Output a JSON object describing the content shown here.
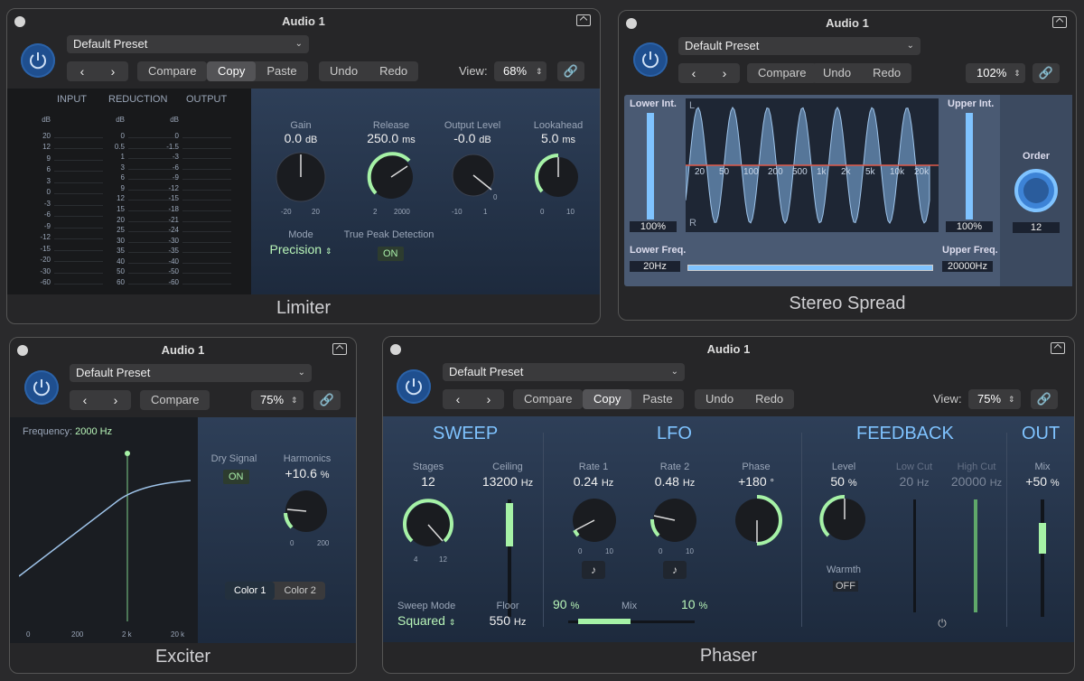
{
  "limiter": {
    "title": "Audio 1",
    "preset": "Default Preset",
    "compare": "Copy",
    "compare_label": "Compare",
    "copy": "Copy",
    "paste": "Paste",
    "undo": "Undo",
    "redo": "Redo",
    "view_label": "View:",
    "view": "68%",
    "footer": "Limiter",
    "meter_labels": [
      "INPUT",
      "REDUCTION",
      "OUTPUT"
    ],
    "db": "dB",
    "input_scale": [
      "20",
      "12",
      "9",
      "6",
      "3",
      "0",
      "-3",
      "-6",
      "-9",
      "-12",
      "-15",
      "-20",
      "-30",
      "-60"
    ],
    "reduction_scale": [
      "0",
      "0.5",
      "1",
      "3",
      "6",
      "9",
      "12",
      "15",
      "20",
      "25",
      "30",
      "35",
      "40",
      "50",
      "60"
    ],
    "output_scale": [
      "0",
      "-1.5",
      "-3",
      "-6",
      "-9",
      "-12",
      "-15",
      "-18",
      "-21",
      "-24",
      "-30",
      "-35",
      "-40",
      "-50",
      "-60"
    ],
    "gain_label": "Gain",
    "gain": "0.0",
    "gain_unit": "dB",
    "gain_min": "-20",
    "gain_max": "20",
    "release_label": "Release",
    "release": "250.0",
    "release_unit": "ms",
    "release_min": "2",
    "release_max": "2000",
    "output_label": "Output Level",
    "output": "-0.0",
    "output_unit": "dB",
    "output_min": "-10",
    "output_max": "1",
    "output_zero": "0",
    "look_label": "Lookahead",
    "look": "5.0",
    "look_unit": "ms",
    "look_min": "0",
    "look_max": "10",
    "mode_label": "Mode",
    "mode": "Precision",
    "tpd_label": "True Peak Detection",
    "tpd": "ON"
  },
  "stereo": {
    "title": "Audio 1",
    "preset": "Default Preset",
    "compare": "Compare",
    "undo": "Undo",
    "redo": "Redo",
    "view": "102%",
    "footer": "Stereo Spread",
    "lower_int_label": "Lower Int.",
    "lower_int": "100%",
    "upper_int_label": "Upper Int.",
    "upper_int": "100%",
    "order_label": "Order",
    "order": "12",
    "lower_freq_label": "Lower Freq.",
    "lower_freq": "20Hz",
    "upper_freq_label": "Upper Freq.",
    "upper_freq": "20000Hz",
    "freq_ticks": [
      "20",
      "50",
      "100",
      "200",
      "500",
      "1k",
      "2k",
      "5k",
      "10k",
      "20k"
    ],
    "l": "L",
    "r": "R"
  },
  "exciter": {
    "title": "Audio 1",
    "preset": "Default Preset",
    "compare": "Compare",
    "view": "75%",
    "footer": "Exciter",
    "freq_label": "Frequency:",
    "freq": "2000 Hz",
    "x_ticks": [
      "0",
      "200",
      "2 k",
      "20 k"
    ],
    "dry_label": "Dry Signal",
    "dry": "ON",
    "harm_label": "Harmonics",
    "harm": "+10.6",
    "harm_unit": "%",
    "harm_min": "0",
    "harm_max": "200",
    "color1": "Color 1",
    "color2": "Color 2"
  },
  "phaser": {
    "title": "Audio 1",
    "preset": "Default Preset",
    "compare": "Compare",
    "copy": "Copy",
    "paste": "Paste",
    "undo": "Undo",
    "redo": "Redo",
    "view_label": "View:",
    "view": "75%",
    "footer": "Phaser",
    "sweep": "SWEEP",
    "lfo": "LFO",
    "feedback": "FEEDBACK",
    "out": "OUT",
    "stages_label": "Stages",
    "stages": "12",
    "stages_min": "4",
    "stages_max": "12",
    "ceiling_label": "Ceiling",
    "ceiling": "13200",
    "hz": "Hz",
    "floor_label": "Floor",
    "floor": "550",
    "sweepmode_label": "Sweep Mode",
    "sweepmode": "Squared",
    "rate1_label": "Rate 1",
    "rate1": "0.24",
    "rate2_label": "Rate 2",
    "rate2": "0.48",
    "rate_min": "0",
    "rate_max": "10",
    "phase_label": "Phase",
    "phase": "+180",
    "deg": "°",
    "mix_label": "Mix",
    "mix_left": "90",
    "mix_right": "10",
    "pct": "%",
    "level_label": "Level",
    "level": "50",
    "warmth_label": "Warmth",
    "warmth": "OFF",
    "lowcut_label": "Low Cut",
    "lowcut": "20",
    "highcut_label": "High Cut",
    "highcut": "20000",
    "outmix_label": "Mix",
    "outmix": "+50"
  }
}
